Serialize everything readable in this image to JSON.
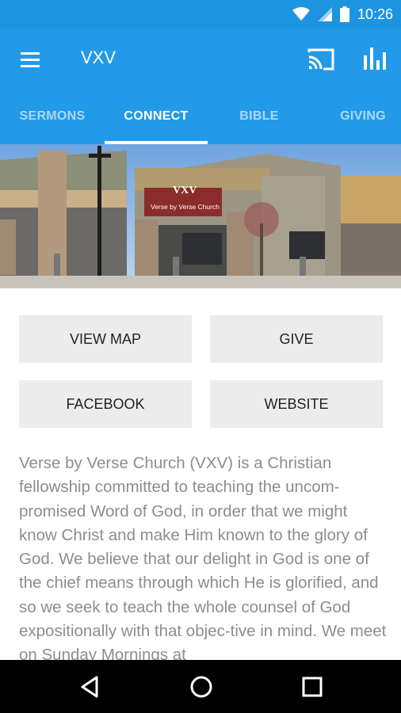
{
  "status_bar": {
    "time": "10:26"
  },
  "app_bar": {
    "title": "VXV",
    "icons": [
      "menu-icon",
      "cast-icon",
      "bar-chart-icon"
    ]
  },
  "tabs": [
    {
      "label": "SERMONS",
      "active": false
    },
    {
      "label": "CONNECT",
      "active": true
    },
    {
      "label": "BIBLE",
      "active": false
    },
    {
      "label": "GIVING",
      "active": false
    }
  ],
  "hero": {
    "sign_logo": "VXV",
    "sign_text": "Verse by Verse Church"
  },
  "buttons": {
    "view_map": "VIEW MAP",
    "give": "GIVE",
    "facebook": "FACEBOOK",
    "website": "WEBSITE"
  },
  "description": "Verse by Verse Church (VXV) is a Christian fellowship committed to teaching the uncom-promised Word of God, in order that we might know Christ and make Him known to the glory of God.  We believe that our delight in God is one of the chief means through which He is glorified, and so we seek to teach the whole counsel of God expositionally with that objec-tive in mind.  We meet on Sunday Mornings at",
  "colors": {
    "primary": "#239ae8",
    "status_bar": "#1c94e0",
    "button_bg": "#ececec",
    "text_muted": "#8d8d8d"
  },
  "nav_bar": {
    "icons": [
      "back-icon",
      "home-icon",
      "recents-icon"
    ]
  }
}
